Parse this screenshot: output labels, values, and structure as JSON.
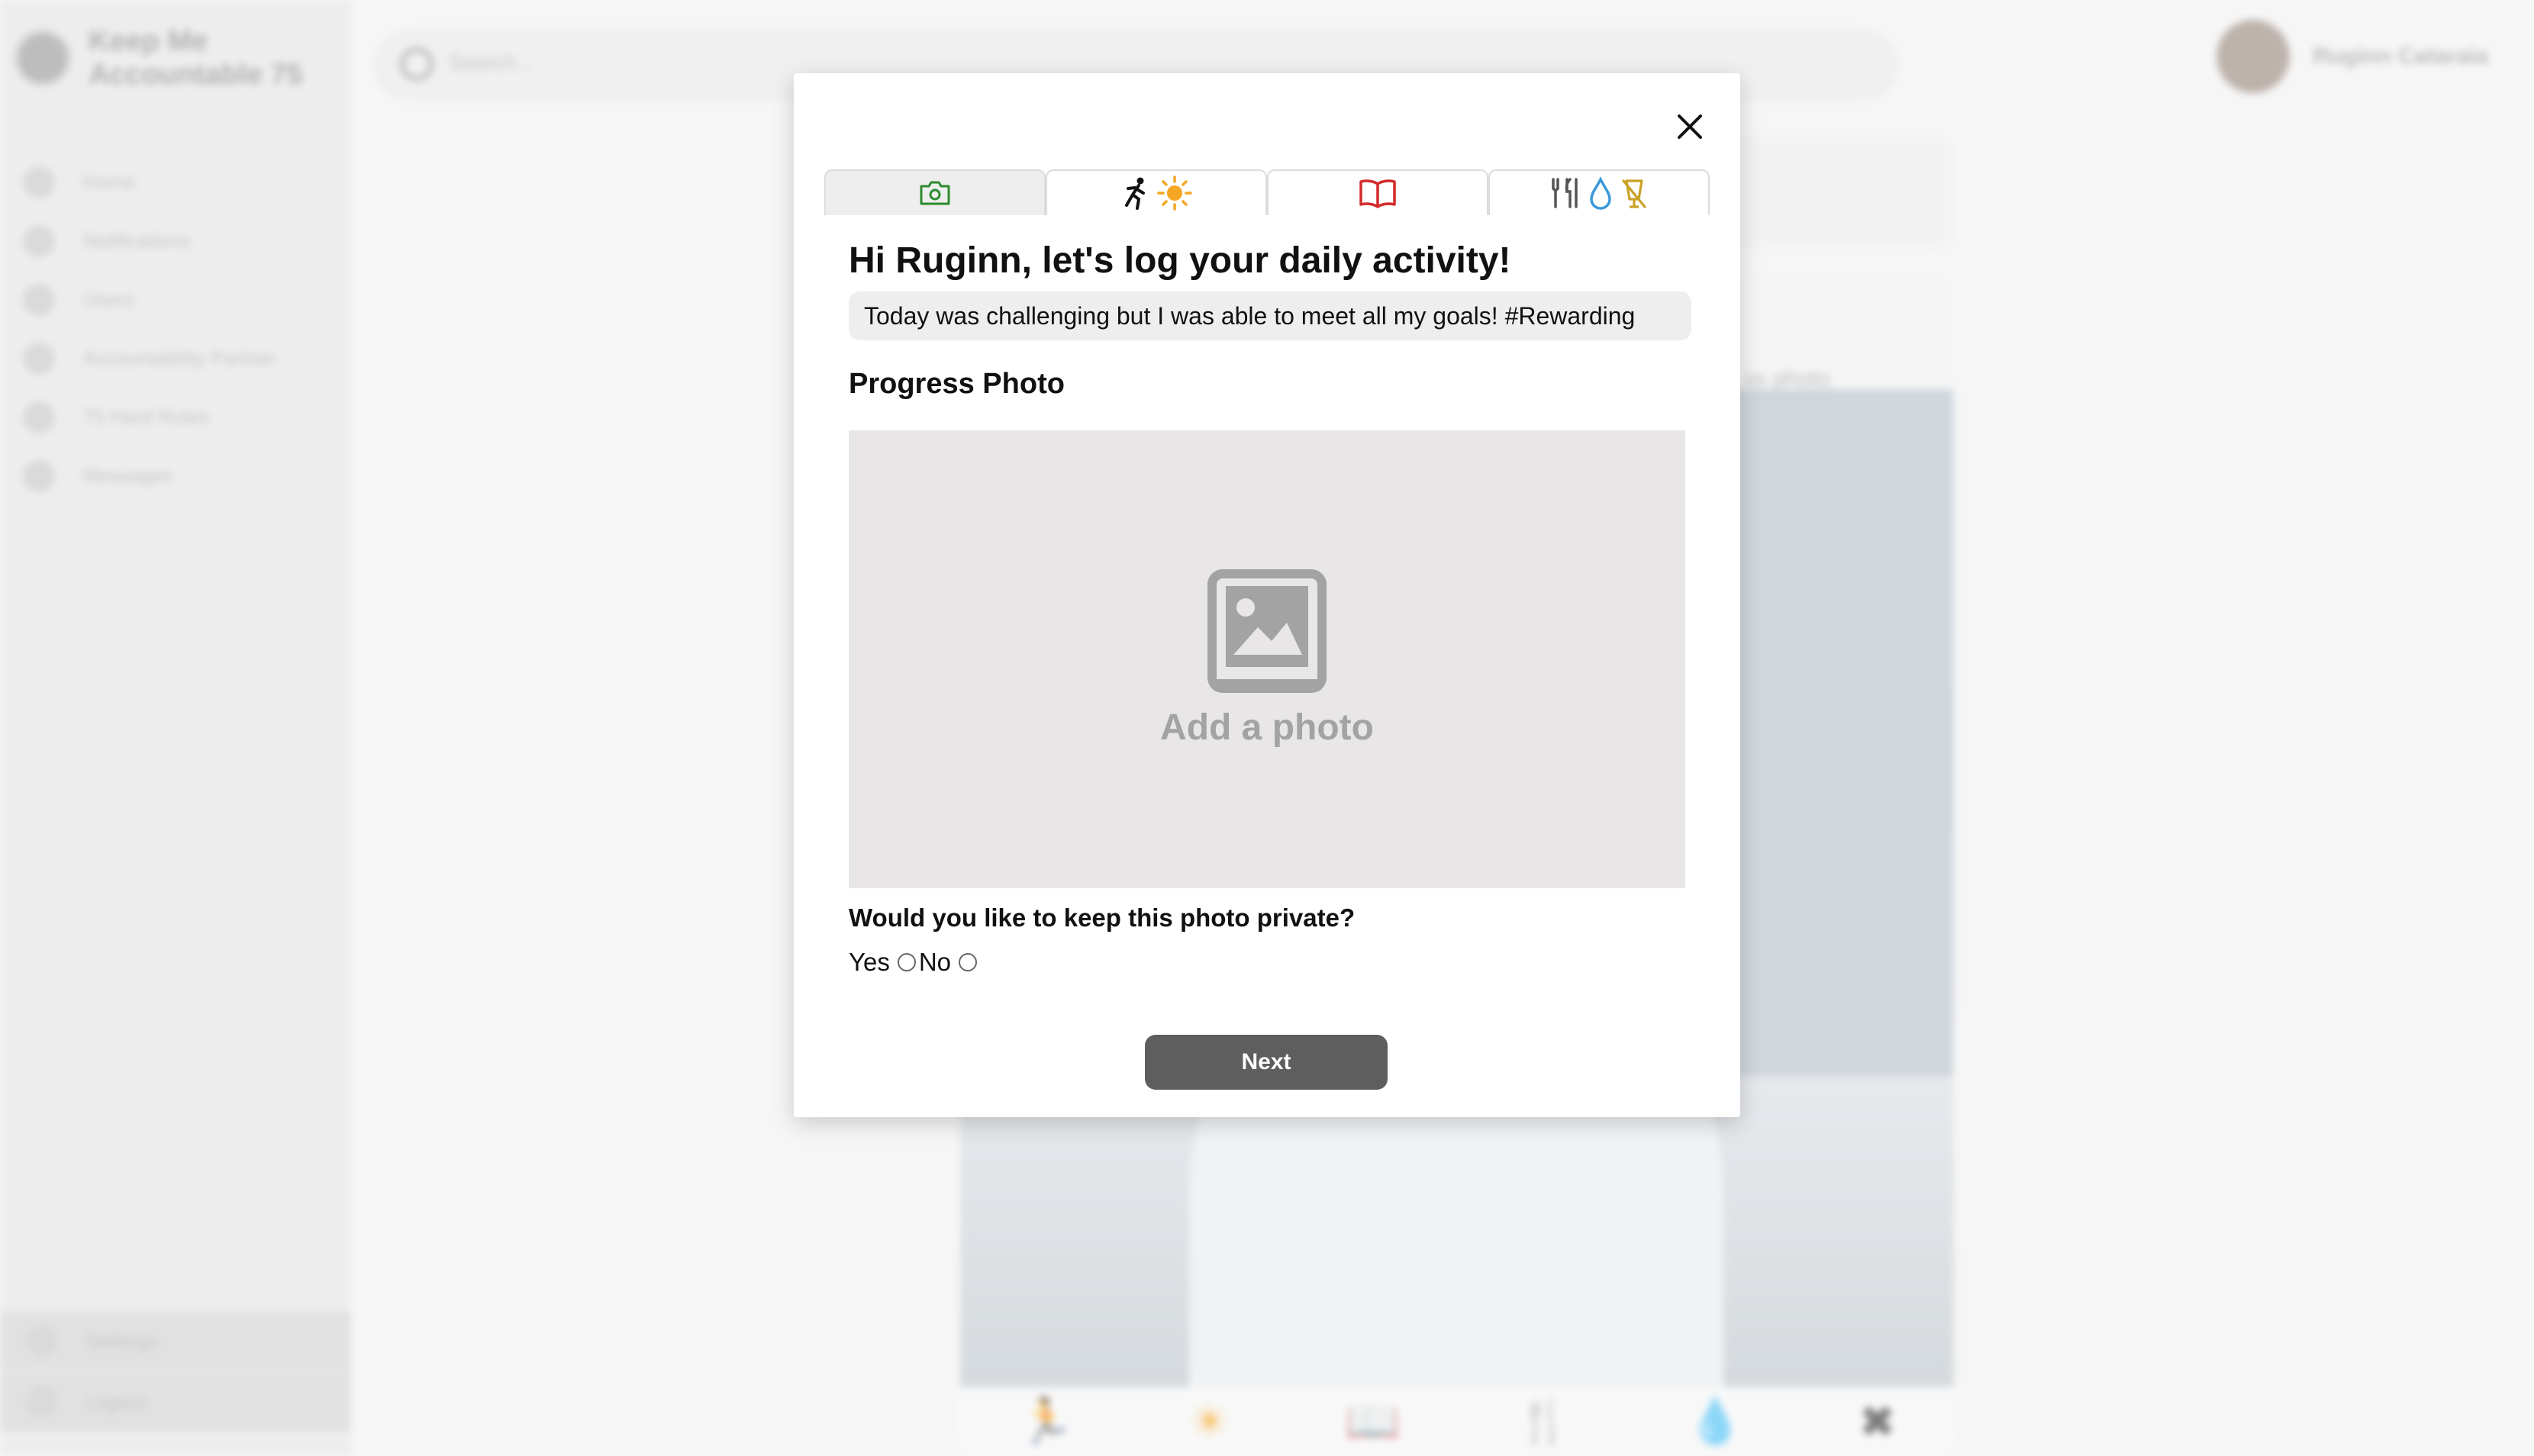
{
  "app": {
    "brand_name": "Keep Me Accountable 75",
    "search_placeholder": "Search...",
    "user_name": "Ruginn Cataraia"
  },
  "sidebar": {
    "items": [
      {
        "label": "Home",
        "icon": "home-icon"
      },
      {
        "label": "Notifications",
        "icon": "bell-icon"
      },
      {
        "label": "Users",
        "icon": "user-icon"
      },
      {
        "label": "Accountability Partner",
        "icon": "handshake-icon"
      },
      {
        "label": "75 Hard Rules",
        "icon": "book-icon"
      },
      {
        "label": "Messages",
        "icon": "message-icon"
      }
    ],
    "bottom": [
      {
        "label": "Settings",
        "icon": "gear-icon"
      },
      {
        "label": "Logout",
        "icon": "logout-icon"
      }
    ]
  },
  "feed": {
    "caption": "..ss photo"
  },
  "modal": {
    "tabs": [
      {
        "name": "photo",
        "icon": "camera-icon",
        "color": "#2e8b2e"
      },
      {
        "name": "workouts",
        "icon": "runner-sun-icon",
        "color": "#f5a623"
      },
      {
        "name": "reading",
        "icon": "open-book-icon",
        "color": "#d42a2a"
      },
      {
        "name": "diet",
        "icon": "utensils-water-no-alcohol-icon",
        "color": "#c9a227"
      }
    ],
    "heading": "Hi Ruginn, let's log your daily activity!",
    "note_value": "Today was challenging but I was able to meet all my goals! #Rewarding",
    "section_title": "Progress Photo",
    "dropzone_label": "Add a photo",
    "privacy_question": "Would you like to keep this photo private?",
    "yes_label": "Yes",
    "no_label": "No",
    "next_label": "Next"
  }
}
